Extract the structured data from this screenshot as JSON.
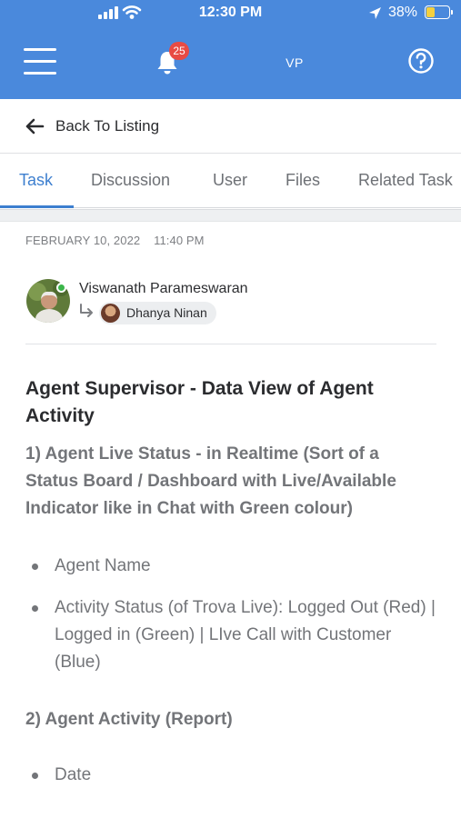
{
  "status_bar": {
    "time": "12:30 PM",
    "battery": "38%",
    "battery_level": 0.38
  },
  "header": {
    "notification_count": "25",
    "user_initials": "VP",
    "icons": [
      "menu-icon",
      "bell-icon",
      "help-icon"
    ]
  },
  "nav": {
    "back_label": "Back To Listing"
  },
  "tabs": [
    {
      "label": "Task",
      "active": true
    },
    {
      "label": "Discussion",
      "active": false
    },
    {
      "label": "User",
      "active": false
    },
    {
      "label": "Files",
      "active": false
    },
    {
      "label": "Related Task",
      "active": false
    }
  ],
  "post": {
    "date": "FEBRUARY 10, 2022",
    "time": "11:40 PM",
    "author": "Viswanath Parameswaran",
    "assignee": "Dhanya Ninan",
    "title": "Agent Supervisor - Data View of Agent Activity",
    "section1": "1) Agent Live Status - in Realtime (Sort of a Status Board / Dashboard with Live/Available Indicator like in Chat with Green colour)",
    "section1_items": [
      "Agent Name",
      "Activity Status (of Trova Live): Logged Out (Red) | Logged in (Green) | LIve Call with Customer (Blue)"
    ],
    "section2": "2) Agent Activity (Report)",
    "section2_items": [
      "Date"
    ]
  },
  "colors": {
    "header_bg": "#4a89dc",
    "accent": "#3d7fcf",
    "badge": "#e84b44",
    "online": "#3bb54a"
  }
}
